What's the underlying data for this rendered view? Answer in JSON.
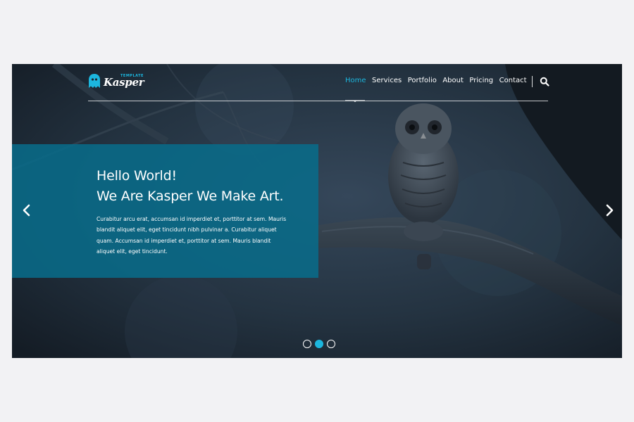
{
  "brand": {
    "tag": "TEMPLATE",
    "name": "Kasper",
    "logo_icon": "ghost-icon",
    "accent_color": "#1cb6de"
  },
  "nav": {
    "items": [
      {
        "label": "Home",
        "active": true
      },
      {
        "label": "Services",
        "active": false
      },
      {
        "label": "Portfolio",
        "active": false
      },
      {
        "label": "About",
        "active": false
      },
      {
        "label": "Pricing",
        "active": false
      },
      {
        "label": "Contact",
        "active": false
      }
    ],
    "search_icon": "search-icon"
  },
  "hero": {
    "title_line1": "Hello World!",
    "title_line2": "We Are Kasper We Make Art.",
    "text_lines": [
      "Curabitur arcu erat, accumsan id imperdiet et, porttitor at sem. Mauris",
      "blandit aliquet elit, eget tincidunt nibh pulvinar a. Curabitur aliquet",
      "quam. Accumsan id imperdiet et, porttitor at sem. Mauris blandit",
      "aliquet elit, eget tincidunt."
    ],
    "caption_color": "#086c8a",
    "prev_icon": "chevron-left-icon",
    "next_icon": "chevron-right-icon"
  },
  "slider": {
    "slide_count": 3,
    "active_index": 1
  }
}
